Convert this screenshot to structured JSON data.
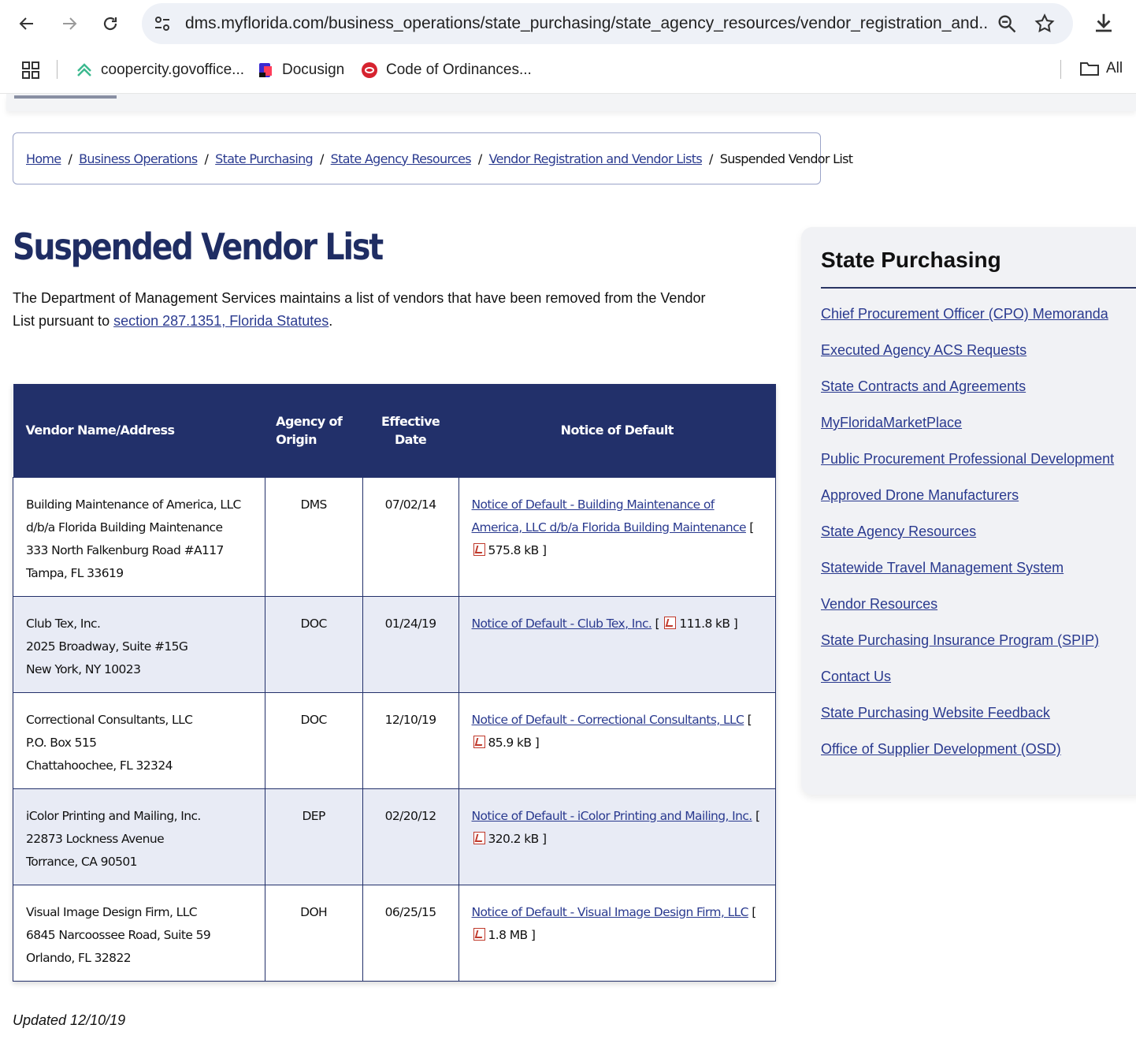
{
  "browser": {
    "url": "dms.myflorida.com/business_operations/state_purchasing/state_agency_resources/vendor_registration_and...",
    "bookmarks": [
      {
        "label": "coopercity.govoffice...",
        "icon": "coopercity-favicon"
      },
      {
        "label": "Docusign",
        "icon": "docusign-favicon"
      },
      {
        "label": "Code of Ordinances...",
        "icon": "municode-favicon"
      }
    ],
    "all_bookmarks_label": "All"
  },
  "breadcrumb": {
    "items": [
      "Home",
      "Business Operations",
      "State Purchasing",
      "State Agency Resources",
      "Vendor Registration and Vendor Lists"
    ],
    "current": "Suspended Vendor List"
  },
  "page": {
    "title": "Suspended Vendor List",
    "intro_text": "The Department of Management Services maintains a list of vendors that have been removed from the Vendor List pursuant to ",
    "intro_link": "section 287.1351, Florida Statutes",
    "intro_end": ".",
    "updated": "Updated 12/10/19"
  },
  "table": {
    "headers": {
      "vendor": "Vendor Name/Address",
      "agency": "Agency of Origin",
      "date": "Effective Date",
      "notice": "Notice of Default"
    },
    "rows": [
      {
        "lines": [
          "Building Maintenance of America, LLC",
          "d/b/a Florida Building Maintenance",
          "333 North Falkenburg Road #A117",
          "Tampa, FL 33619"
        ],
        "agency": "DMS",
        "date": "07/02/14",
        "notice_link": "Notice of Default - Building Maintenance of America, LLC d/b/a Florida Building Maintenance",
        "size": "575.8 kB"
      },
      {
        "lines": [
          "Club Tex, Inc.",
          "2025 Broadway, Suite #15G",
          "New York, NY 10023"
        ],
        "agency": "DOC",
        "date": "01/24/19",
        "notice_link": "Notice of Default - Club Tex, Inc.",
        "size": "111.8 kB"
      },
      {
        "lines": [
          "Correctional Consultants, LLC",
          "P.O. Box 515",
          "Chattahoochee, FL 32324"
        ],
        "agency": "DOC",
        "date": "12/10/19",
        "notice_link": "Notice of Default - Correctional Consultants, LLC",
        "size": "85.9 kB"
      },
      {
        "lines": [
          "iColor Printing and Mailing, Inc.",
          "22873 Lockness Avenue",
          "Torrance, CA 90501"
        ],
        "agency": "DEP",
        "date": "02/20/12",
        "notice_link": "Notice of Default - iColor Printing and Mailing, Inc.",
        "size": "320.2 kB"
      },
      {
        "lines": [
          "Visual Image Design Firm, LLC",
          "6845 Narcoossee Road, Suite 59",
          "Orlando, FL 32822"
        ],
        "agency": "DOH",
        "date": "06/25/15",
        "notice_link": "Notice of Default - Visual Image Design Firm, LLC",
        "size": "1.8 MB"
      }
    ]
  },
  "sidebar": {
    "title": "State Purchasing",
    "links": [
      "Chief Procurement Officer (CPO) Memoranda",
      "Executed Agency ACS Requests",
      "State Contracts and Agreements",
      "MyFloridaMarketPlace",
      "Public Procurement Professional Development",
      "Approved Drone Manufacturers",
      "State Agency Resources",
      "Statewide Travel Management System",
      "Vendor Resources",
      "State Purchasing Insurance Program (SPIP)",
      "Contact Us",
      "State Purchasing Website Feedback",
      "Office of Supplier Development (OSD)"
    ]
  },
  "colors": {
    "navy": "#22306a",
    "link": "#2a3a8f",
    "alt_row": "#e8ebf5"
  }
}
